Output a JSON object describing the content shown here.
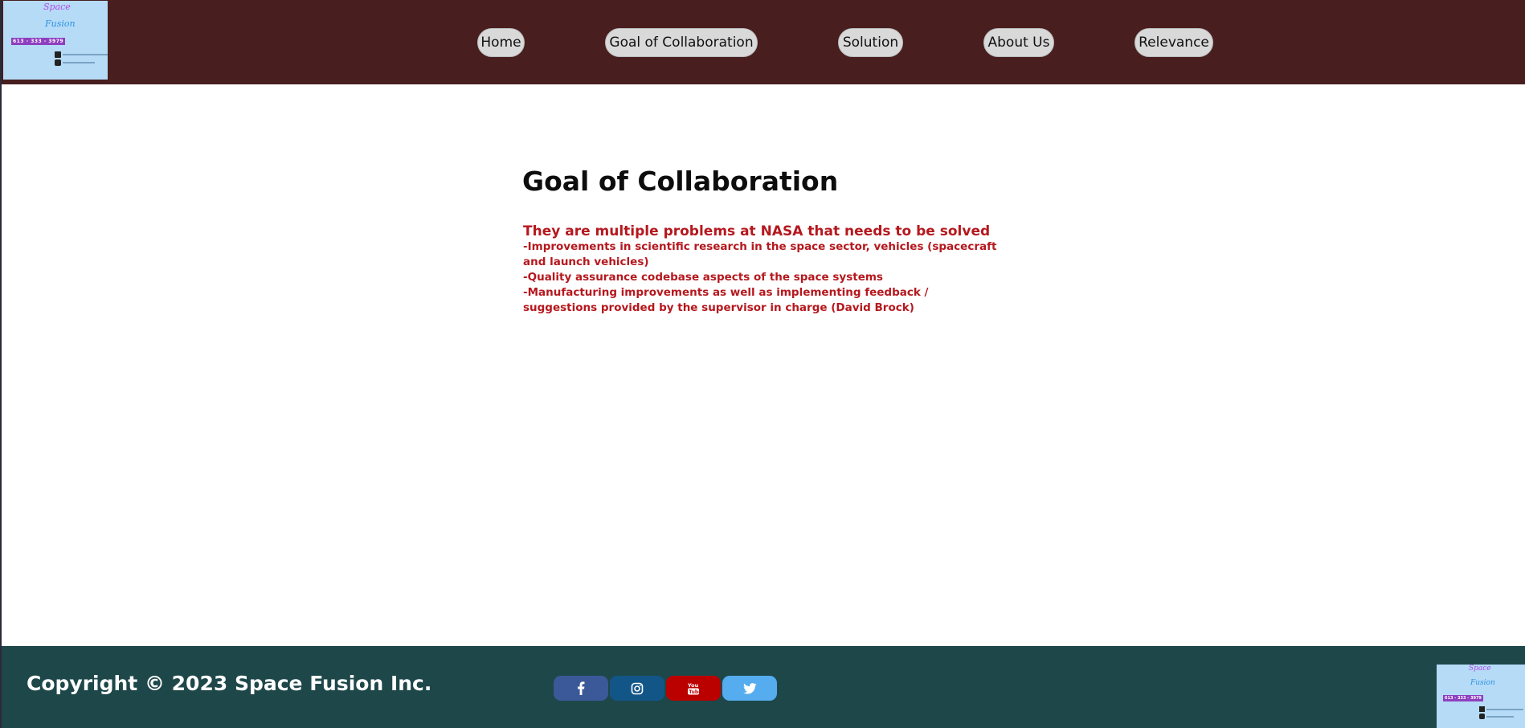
{
  "header": {
    "logo": {
      "line1": "Space",
      "line2": "Fusion",
      "phone": "613 - 333 - 3979"
    },
    "nav": [
      {
        "label": "Home"
      },
      {
        "label": "Goal of Collaboration"
      },
      {
        "label": "Solution"
      },
      {
        "label": "About Us"
      },
      {
        "label": "Relevance"
      }
    ]
  },
  "main": {
    "title": "Goal of Collaboration",
    "lead": "They are multiple problems at NASA that needs to be solved",
    "lines": [
      "-Improvements in scientific research in the space sector, vehicles (spacecraft and launch vehicles)",
      "-Quality assurance codebase aspects of the space systems",
      "-Manufacturing improvements as well as implementing feedback / suggestions provided by the supervisor in charge (David Brock)"
    ]
  },
  "footer": {
    "copyright": "Copyright © 2023 Space Fusion Inc.",
    "social": [
      {
        "icon": "facebook-icon",
        "color": "#3b5998"
      },
      {
        "icon": "instagram-icon",
        "color": "#125688"
      },
      {
        "icon": "youtube-icon",
        "color": "#bb0000"
      },
      {
        "icon": "twitter-icon",
        "color": "#55acee"
      }
    ],
    "logo": {
      "line1": "Space",
      "line2": "Fusion",
      "phone": "613 - 333 - 3979"
    }
  },
  "colors": {
    "header_bg": "#481e1f",
    "footer_bg": "#1e474a",
    "accent_text": "#b5181e",
    "nav_button_bg": "#d9d9d9",
    "logo_bg": "#b5dbf7"
  }
}
